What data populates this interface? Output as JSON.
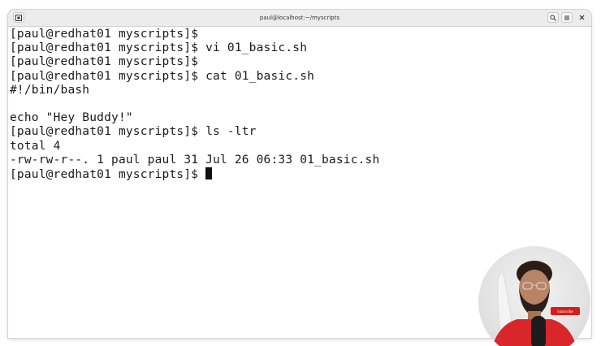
{
  "window": {
    "title": "paul@localhost:~/myscripts"
  },
  "terminal": {
    "lines": [
      "[paul@redhat01 myscripts]$",
      "[paul@redhat01 myscripts]$ vi 01_basic.sh",
      "[paul@redhat01 myscripts]$",
      "[paul@redhat01 myscripts]$ cat 01_basic.sh",
      "#!/bin/bash",
      "",
      "echo \"Hey Buddy!\"",
      "[paul@redhat01 myscripts]$ ls -ltr",
      "total 4",
      "-rw-rw-r--. 1 paul paul 31 Jul 26 06:33 01_basic.sh",
      "[paul@redhat01 myscripts]$ "
    ]
  },
  "icons": {
    "new_tab": "new-tab-icon",
    "search": "search-icon",
    "menu": "hamburger-menu-icon",
    "close": "close-icon"
  },
  "webcam": {
    "badge_text": "Subscribe"
  },
  "colors": {
    "titlebar": "#ececec",
    "terminal_bg": "#ffffff",
    "terminal_fg": "#1a1a1a",
    "shirt": "#d9262b"
  }
}
